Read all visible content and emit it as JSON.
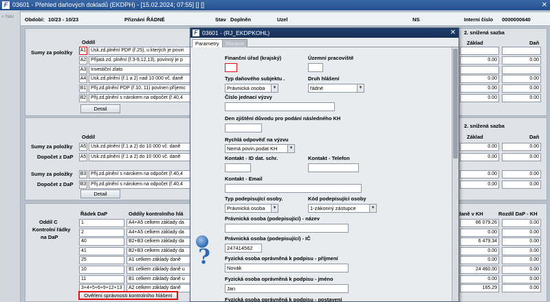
{
  "window": {
    "title": "03601 - Přehled daňových dokladů (EKDPH) - [15.02.2024; 07:55] [] []",
    "close": "✕"
  },
  "nav": {
    "label": "« Nav"
  },
  "header": {
    "obdobi_label": "Období:",
    "obdobi_value": "10/23 - 10/23",
    "priznani_label": "Přiznání",
    "priznani_value": "ŘÁDNÉ",
    "stav_label": "Stav",
    "stav_value": "Doplněn",
    "uzel_label": "Uzel",
    "ns_label": "NS",
    "interni_label": "Interní číslo",
    "interni_value": "0000000640"
  },
  "panel1": {
    "oddil_label": "Oddíl",
    "sumy_label": "Sumy za položky",
    "snizena_label": "2. snížená sazba",
    "zaklad_label": "Základ",
    "dan_label": "Daň",
    "rows": [
      {
        "code": "A1",
        "text": "Usk.zd.plnění PDP (ř.25), u kterých je povin",
        "zaklad": "",
        "dan": ""
      },
      {
        "code": "A2",
        "text": "Přijatá zd. plnění (ř.3-9,12,13), povinný je p",
        "zaklad": "0.00",
        "dan": "0.00"
      },
      {
        "code": "A3",
        "text": "Investiční zlato",
        "zaklad": "",
        "dan": ""
      },
      {
        "code": "A4",
        "text": "Usk.zd.plnění (ř.1 a 2) nad 10 000 vč. daně",
        "zaklad": "0.00",
        "dan": "0.00"
      },
      {
        "code": "B1",
        "text": "Přij.zd.plnění PDP (ř.10, 11) povinen příjemc",
        "zaklad": "0.00",
        "dan": "0.00"
      },
      {
        "code": "B2",
        "text": "Přij.zd.plnění s nárokem na odpočet (ř.40,4",
        "zaklad": "0.00",
        "dan": "0.00"
      }
    ],
    "detail_label": "Detail"
  },
  "panel2": {
    "oddil_label": "Oddíl",
    "snizena_label": "2. snížená sazba",
    "zaklad_label": "Základ",
    "dan_label": "Daň",
    "rows": [
      {
        "left": "Sumy za položky",
        "code": "A5",
        "text": "Usk.zd.plnění (ř.1 a 2) do 10 000 vč. daně",
        "zaklad": "0.00",
        "dan": "0.00"
      },
      {
        "left": "Dopočet z DaP",
        "code": "A5",
        "text": "Usk.zd.plnění (ř.1 a 2) do 10 000 vč. daně",
        "zaklad": "0.00",
        "dan": "0.00"
      },
      {
        "left": "Sumy za položky",
        "code": "B3",
        "text": "Přij.zd.plnění s nárokem na odpočet (ř.40,4",
        "zaklad": "0.00",
        "dan": "0.00"
      },
      {
        "left": "Dopočet z DaP",
        "code": "B3",
        "text": "Přij.zd.plnění s nárokem na odpočet (ř.40,4",
        "zaklad": "0.00",
        "dan": "0.00"
      }
    ],
    "detail_label": "Detail"
  },
  "panel3": {
    "left_label_1": "Oddíl C",
    "left_label_2": "Kontrolní řádky",
    "left_label_3": "na DaP",
    "col_radek": "Řádek DaP",
    "col_oddily": "Oddíly kontrolního hlá",
    "col_dan_kh": "daně v KH",
    "col_rozdil": "Rozdíl DaP - KH",
    "rows": [
      {
        "radek": "1",
        "oddil": "A4+A5 celkem základy da",
        "dan_kh": "86 079.26",
        "rozdil": "0.00"
      },
      {
        "radek": "2",
        "oddil": "A4+A5 celkem základy da",
        "dan_kh": "0.00",
        "rozdil": "0.00"
      },
      {
        "radek": "40",
        "oddil": "B2+B3 celkem základy da",
        "dan_kh": "6 479.34",
        "rozdil": "0.00"
      },
      {
        "radek": "41",
        "oddil": "B2+B3 celkem základy da",
        "dan_kh": "0.00",
        "rozdil": "0.00"
      },
      {
        "radek": "25",
        "oddil": "A1 celkem základy daně",
        "dan_kh": "0.00",
        "rozdil": "0.00"
      },
      {
        "radek": "10",
        "oddil": "B1 celkem základy daně u",
        "dan_kh": "24 460.00",
        "rozdil": "0.00"
      },
      {
        "radek": "11",
        "oddil": "B1 celkem základy daně u",
        "dan_kh": "0.00",
        "rozdil": "0.00"
      },
      {
        "radek": "3+4+5+6+9+12+13",
        "oddil": "A2 celkem základy daně",
        "dan_kh": "165.29",
        "rozdil": "0.00"
      }
    ],
    "verify_button": "Ověření správnosti kontrolního hlášení"
  },
  "dialog": {
    "title": "03601 - (RJ_EKDPKOHL)",
    "close": "✕",
    "tabs": [
      "Parametry",
      "Sloupce"
    ],
    "financni_urad_label": "Finanční úřad (krajský)",
    "financni_urad_value": "",
    "uzemni_label": "Územní pracoviště",
    "uzemni_value": "",
    "typ_subjektu_label": "Typ daňového subjektu .",
    "typ_subjektu_value": "Právnická osoba",
    "druh_hlaseni_label": "Druh hlášení",
    "druh_hlaseni_value": "řádné",
    "cislo_jednaci_label": "Číslo jednací výzvy",
    "cislo_jednaci_value": "",
    "den_zjisteni_label": "Den zjištění důvodu pro podání následného KH",
    "den_zjisteni_value": "",
    "rychla_odpoved_label": "Rychlá odpověď na výzvu",
    "rychla_odpoved_value": "Nemá povin.podat KH",
    "kontakt_ds_label": "Kontakt - ID dat. schr.",
    "kontakt_ds_value": "",
    "kontakt_tel_label": "Kontakt - Telefon",
    "kontakt_tel_value": "",
    "kontakt_email_label": "Kontakt - Email",
    "kontakt_email_value": "",
    "typ_podep_label": "Typ podepisující osoby.",
    "typ_podep_value": "Právnická osoba",
    "kod_podep_label": "Kód podepisující osoby",
    "kod_podep_value": "1-zákonný zástupce",
    "po_nazev_label": "Právnická osoba (podepisující) - název",
    "po_nazev_value": "",
    "po_ic_label": "Právnická osoba (podepisující) - IČ",
    "po_ic_value": "247414562",
    "fo_prijmeni_label": "Fyzická osoba oprávněná k podpisu - příjmení",
    "fo_prijmeni_value": "Novák",
    "fo_jmeno_label": "Fyzická osoba oprávněná k podpisu - jméno",
    "fo_jmeno_value": "Jan",
    "fo_postaveni_label": "Fyzická osoba oprávněná k podpisu - postavení"
  },
  "colors": {
    "title_bar": "#23508f",
    "dialog_title": "#1f3f6e",
    "highlight_red": "#e01010",
    "panel_bg": "#dfe3e8"
  }
}
